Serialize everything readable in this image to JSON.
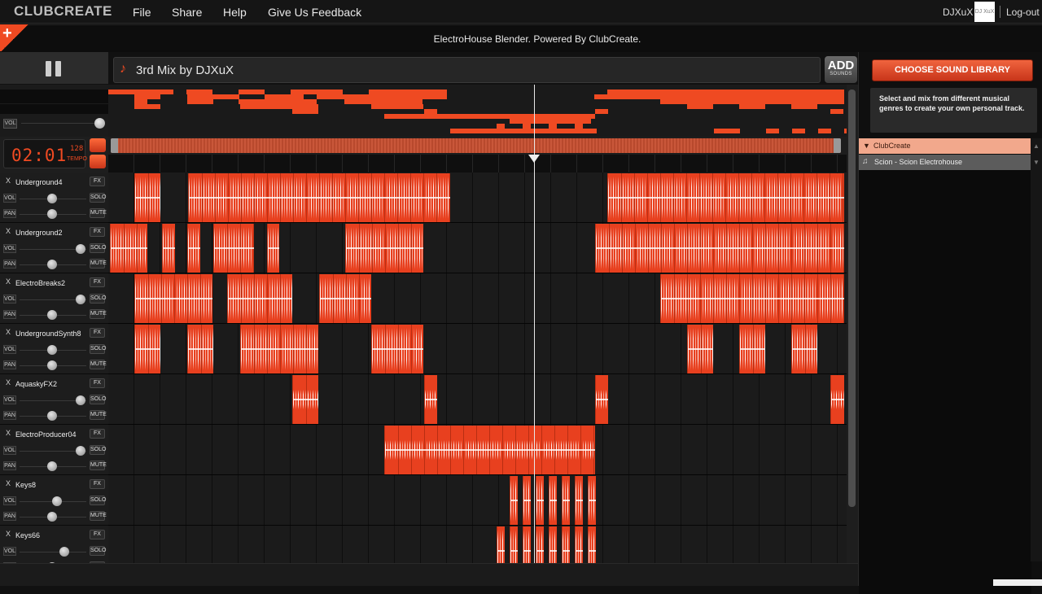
{
  "topbar": {
    "logo": "CLUBCREATE",
    "menu": [
      "File",
      "Share",
      "Help",
      "Give Us Feedback"
    ],
    "user": "DJXuX",
    "avatar_text": "DJ XuX",
    "logout": "Log-out"
  },
  "header": {
    "subtitle": "ElectroHouse Blender. Powered By ClubCreate.",
    "add_icon": "plus-icon"
  },
  "mix": {
    "title": "3rd Mix by DJXuX",
    "add_label": "ADD",
    "add_sub": "SOUNDS"
  },
  "master": {
    "vol_label": "VOL",
    "time": "02:01",
    "tempo": "128",
    "tempo_label": "TEMPO"
  },
  "track_labels": {
    "x": "X",
    "fx": "FX",
    "vol": "VOL",
    "pan": "PAN",
    "solo": "SOLO",
    "mute": "MUTE"
  },
  "tracks": [
    {
      "name": "Underground4"
    },
    {
      "name": "Underground2"
    },
    {
      "name": "ElectroBreaks2"
    },
    {
      "name": "UndergroundSynth8"
    },
    {
      "name": "AquaskyFX2"
    },
    {
      "name": "ElectroProducer04"
    },
    {
      "name": "Keys8"
    },
    {
      "name": "Keys66"
    }
  ],
  "sidebar": {
    "choose_button": "CHOOSE SOUND LIBRARY",
    "help_text": "Select and mix from different musical genres to create your own personal track.",
    "library": {
      "folder": "ClubCreate",
      "item": "Scion - Scion Electrohouse"
    }
  },
  "colors": {
    "accent": "#ef4a22",
    "clip": "#e8401f",
    "lib_folder": "#f2a88c"
  }
}
